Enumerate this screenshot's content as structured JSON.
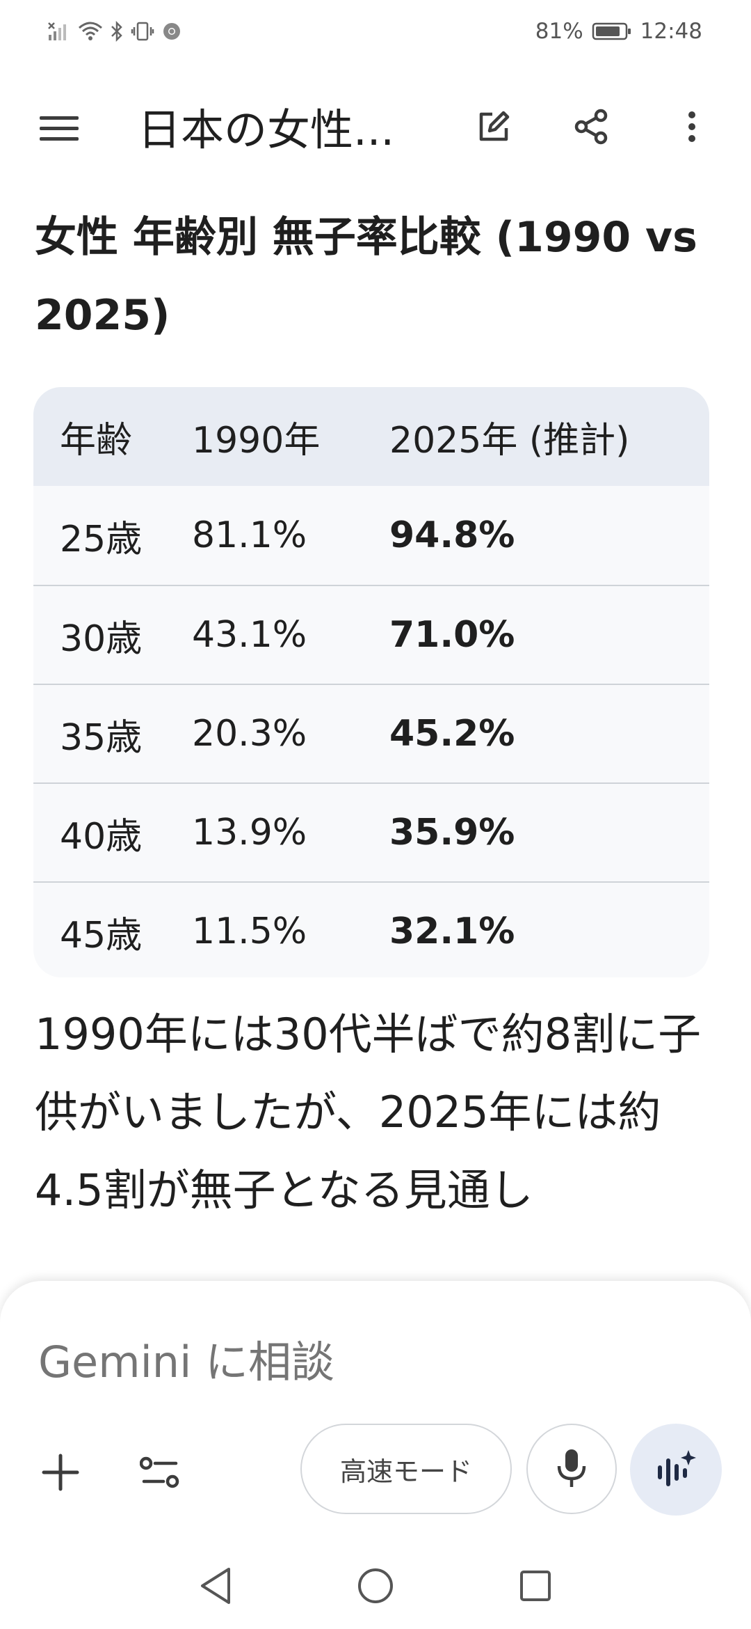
{
  "status_bar": {
    "battery_percent": "81%",
    "time": "12:48",
    "icons": [
      "signal-off-icon",
      "wifi-icon",
      "bluetooth-icon",
      "vibrate-icon",
      "chrome-icon",
      "battery-icon"
    ]
  },
  "app_bar": {
    "title": "日本の女性...",
    "icons": [
      "menu-icon",
      "edit-icon",
      "share-icon",
      "more-vert-icon"
    ]
  },
  "content": {
    "heading": "女性 年齢別 無子率比較 (1990 vs 2025)",
    "table": {
      "headers": [
        "年齢",
        "1990年",
        "2025年 (推計)"
      ],
      "rows": [
        [
          "25歳",
          "81.1%",
          "94.8%"
        ],
        [
          "30歳",
          "43.1%",
          "71.0%"
        ],
        [
          "35歳",
          "20.3%",
          "45.2%"
        ],
        [
          "40歳",
          "13.9%",
          "35.9%"
        ],
        [
          "45歳",
          "11.5%",
          "32.1%"
        ]
      ]
    },
    "paragraph": "1990年には30代半ばで約8割に子供がいましたが、2025年には約4.5割が無子となる見通し"
  },
  "input": {
    "placeholder": "Gemini に相談",
    "mode_label": "高速モード"
  },
  "colors": {
    "table_header_bg": "#e8ecf3",
    "table_body_bg": "#f8f9fb",
    "live_button_bg": "#e6ebf5"
  }
}
